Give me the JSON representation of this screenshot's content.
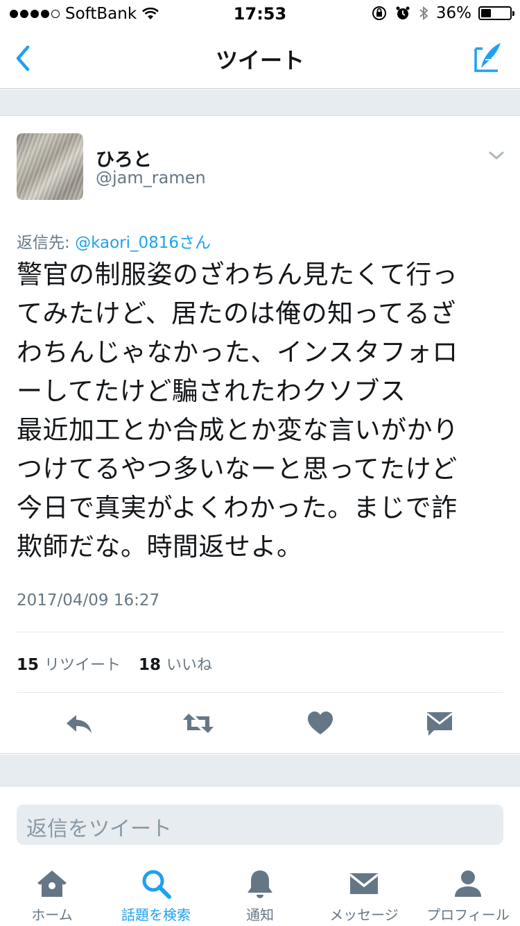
{
  "status_bar": {
    "carrier": "SoftBank",
    "time": "17:53",
    "battery": "36%",
    "battery_level": 0.36
  },
  "nav": {
    "title": "ツイート"
  },
  "tweet": {
    "user_name": "ひろと",
    "handle": "@jam_ramen",
    "reply_to_label": "返信先: ",
    "reply_to_mention": "@kaori_0816さん",
    "text": "警官の制服姿のざわちん見たくて行っ\nてみたけど、居たのは俺の知ってるざ\nわちんじゃなかった、インスタフォロ\nーしてたけど騙されたわクソブス\n最近加工とか合成とか変な言いがかり\nつけてるやつ多いなーと思ってたけど\n今日で真実がよくわかった。まじで詐\n欺師だな。時間返せよ。",
    "timestamp": "2017/04/09 16:27",
    "retweet_count": "15",
    "retweet_label": "リツイート",
    "like_count": "18",
    "like_label": "いいね"
  },
  "reply": {
    "placeholder": "返信をツイート"
  },
  "tabs": [
    {
      "label": "ホーム",
      "icon": "home-icon"
    },
    {
      "label": "話題を検索",
      "icon": "search-icon",
      "active": true
    },
    {
      "label": "通知",
      "icon": "bell-icon"
    },
    {
      "label": "メッセージ",
      "icon": "envelope-icon"
    },
    {
      "label": "プロフィール",
      "icon": "person-icon"
    }
  ],
  "colors": {
    "accent": "#1da1f2",
    "icon_gray": "#657786",
    "background_band": "#e6ecf0"
  }
}
